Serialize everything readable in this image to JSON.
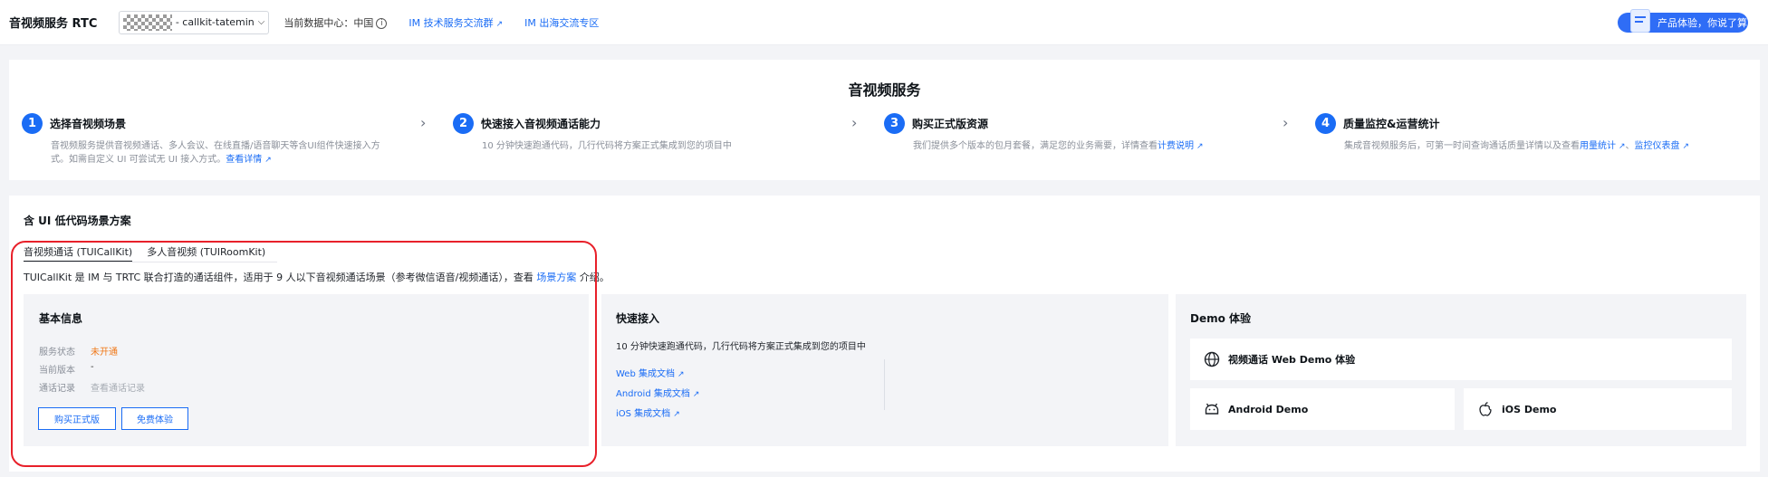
{
  "topbar": {
    "title": "音视频服务 RTC",
    "app_name": "- callkit-tatemin",
    "data_center": "当前数据中心：中国",
    "links": [
      "IM 技术服务交流群",
      "IM 出海交流专区"
    ],
    "promo": "产品体验，你说了算"
  },
  "steps": {
    "title": "音视频服务",
    "items": [
      {
        "num": "1",
        "title": "选择音视频场景",
        "desc": "音视频服务提供音视频通话、多人会议、在线直播/语音聊天等含UI组件快速接入方",
        "desc2": "式。如需自定义 UI 可尝试无 UI 接入方式。",
        "link": "查看详情"
      },
      {
        "num": "2",
        "title": "快速接入音视频通话能力",
        "desc": "10 分钟快速跑通代码，几行代码将方案正式集成到您的项目中"
      },
      {
        "num": "3",
        "title": "购买正式版资源",
        "desc": "我们提供多个版本的包月套餐，满足您的业务需要，详情查看",
        "link": "计费说明"
      },
      {
        "num": "4",
        "title": "质量监控&运营统计",
        "desc": "集成音视频服务后，可第一时间查询通话质量详情以及查看",
        "link": "用量统计",
        "sep": "、",
        "link2": "监控仪表盘"
      }
    ]
  },
  "main": {
    "title": "含 UI 低代码场景方案",
    "tabs": [
      "音视频通话 (TUICallKit)",
      "多人音视频 (TUIRoomKit)"
    ],
    "intro": "TUICallKit 是 IM 与 TRTC 联合打造的通话组件，适用于 9 人以下音视频通话场景（参考微信语音/视频通话），查看",
    "intro_link": "场景方案",
    "intro_tail": "介绍。",
    "basic": {
      "title": "基本信息",
      "rows": [
        {
          "k": "服务状态",
          "v": "未开通"
        },
        {
          "k": "当前版本",
          "v": "-"
        },
        {
          "k": "通话记录",
          "v": "查看通话记录"
        }
      ],
      "buy": "购买正式版",
      "trial": "免费体验"
    },
    "quick": {
      "title": "快速接入",
      "desc": "10 分钟快速跑通代码，几行代码将方案正式集成到您的项目中",
      "links": [
        "Web 集成文档",
        "Android 集成文档",
        "iOS 集成文档"
      ]
    },
    "demo": {
      "title": "Demo 体验",
      "web": "视频通话 Web Demo 体验",
      "android": "Android Demo",
      "ios": "iOS Demo"
    }
  },
  "colors": {
    "accent": "#1a6cf5",
    "warn": "#f07818",
    "highlight": "#e8202a"
  }
}
